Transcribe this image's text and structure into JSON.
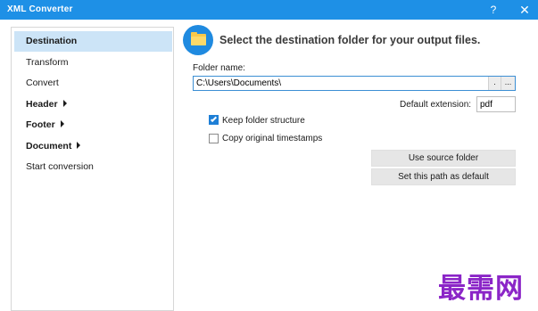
{
  "window": {
    "title": "XML Converter",
    "help_label": "?",
    "close_label": "✕",
    "accent_color": "#1e90e6"
  },
  "sidebar": {
    "items": [
      {
        "label": "Destination",
        "active": true,
        "expandable": false
      },
      {
        "label": "Transform",
        "active": false,
        "expandable": false
      },
      {
        "label": "Convert",
        "active": false,
        "expandable": false
      },
      {
        "label": "Header",
        "active": false,
        "expandable": true
      },
      {
        "label": "Footer",
        "active": false,
        "expandable": true
      },
      {
        "label": "Document",
        "active": false,
        "expandable": true
      },
      {
        "label": "Start conversion",
        "active": false,
        "expandable": false
      }
    ]
  },
  "main": {
    "icon": "folder-icon",
    "heading": "Select the destination folder for your output files.",
    "folder_label": "Folder name:",
    "folder_value": "C:\\Users\\Documents\\",
    "browse_small_label": ".",
    "browse_label": "...",
    "extension_label": "Default extension:",
    "extension_value": "pdf",
    "keep_structure": {
      "label": "Keep folder structure",
      "checked": true
    },
    "copy_timestamps": {
      "label": "Copy original timestamps",
      "checked": false
    },
    "use_source_button": "Use source folder",
    "set_default_button": "Set this path as default"
  },
  "watermark": {
    "text": "最需网",
    "color": "#8b25c7"
  }
}
